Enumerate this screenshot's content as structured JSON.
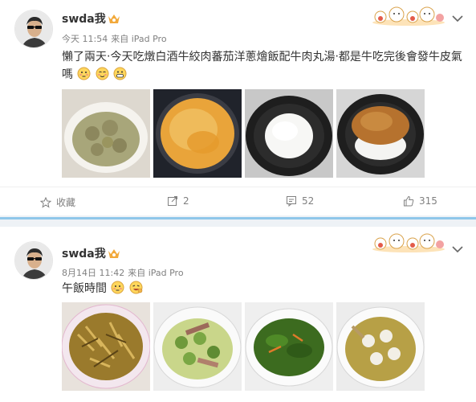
{
  "colors": {
    "accent": "#8fc7ea",
    "vip": "#f2a93b",
    "meta_text": "#808080"
  },
  "posts": [
    {
      "username": "swda我",
      "time": "今天 11:54",
      "source": "来自 iPad Pro",
      "text": "懶了兩天‧今天吃燉白酒牛絞肉蕃茄洋蔥燴飯配牛肉丸湯‧都是牛吃完後會發牛皮氣嗎",
      "emojis": [
        "embarrassed-emoji",
        "blush-emoji",
        "grin-emoji"
      ],
      "images": [
        "meatball-soup-photo",
        "tomato-sauce-pan-photo",
        "white-rice-bowl-photo",
        "beef-rice-bowl-photo"
      ],
      "actions": {
        "favorite": "收藏",
        "repost": "2",
        "comment": "52",
        "like": "315"
      }
    },
    {
      "username": "swda我",
      "time": "8月14日 11:42",
      "source": "来自 iPad Pro",
      "text": "午飯時間",
      "emojis": [
        "embarrassed-emoji",
        "laugh-emoji"
      ],
      "images": [
        "shredded-stirfry-photo",
        "zucchini-stirfry-photo",
        "spinach-stirfry-photo",
        "fishball-soup-photo"
      ]
    }
  ]
}
